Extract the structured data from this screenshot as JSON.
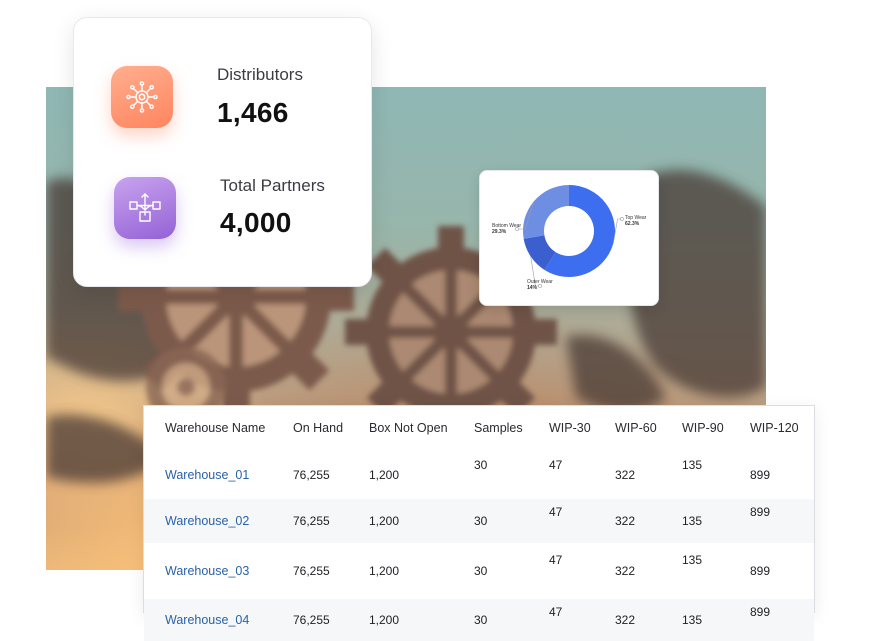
{
  "kpis": [
    {
      "label": "Distributors",
      "value": "1,466",
      "icon": "network-hub-icon",
      "color": "#ff8a66"
    },
    {
      "label": "Total Partners",
      "value": "4,000",
      "icon": "distribution-boxes-icon",
      "color": "#9b6bdb"
    }
  ],
  "donut": {
    "type": "donut",
    "slices": [
      {
        "label": "Top Wear",
        "value": 62.3,
        "pct_text": "62.3%",
        "color": "#3e6ef0"
      },
      {
        "label": "Outer Wear",
        "value": 14,
        "pct_text": "14%",
        "color": "#3b5fcf"
      },
      {
        "label": "Bottom Wear",
        "value": 29.3,
        "pct_text": "29.3%",
        "color": "#6d8ee3"
      }
    ]
  },
  "table": {
    "columns": [
      "Warehouse Name",
      "On Hand",
      "Box Not Open",
      "Samples",
      "WIP-30",
      "WIP-60",
      "WIP-90",
      "WIP-120"
    ],
    "rows": [
      [
        "Warehouse_01",
        "76,255",
        "1,200",
        "30",
        "47",
        "322",
        "135",
        "899"
      ],
      [
        "Warehouse_02",
        "76,255",
        "1,200",
        "30",
        "47",
        "322",
        "135",
        "899"
      ],
      [
        "Warehouse_03",
        "76,255",
        "1,200",
        "30",
        "47",
        "322",
        "135",
        "899"
      ],
      [
        "Warehouse_04",
        "76,255",
        "1,200",
        "30",
        "47",
        "322",
        "135",
        "899"
      ]
    ]
  },
  "colors": {
    "link": "#2a62a8",
    "stripe": "#f6f7f9"
  }
}
